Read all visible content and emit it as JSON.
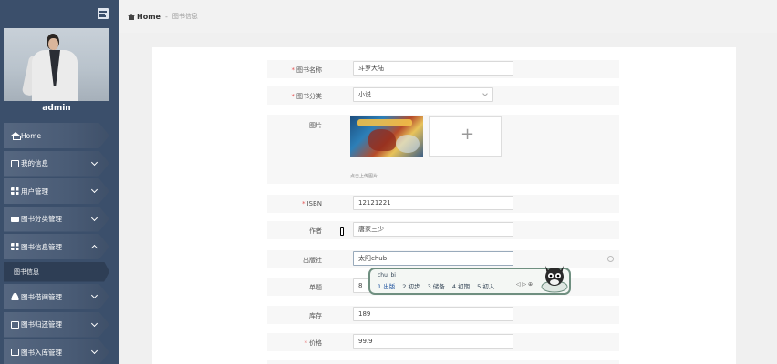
{
  "sidebar": {
    "user_name": "admin",
    "menu": [
      {
        "label": "Home",
        "icon": "home-icon",
        "expandable": false
      },
      {
        "label": "我的信息",
        "icon": "id-card-icon",
        "expandable": true
      },
      {
        "label": "用户管理",
        "icon": "grid-icon",
        "expandable": true
      },
      {
        "label": "图书分类管理",
        "icon": "briefcase-icon",
        "expandable": true
      },
      {
        "label": "图书信息管理",
        "icon": "grid-icon",
        "expandable": true,
        "expanded": true
      }
    ],
    "submenu": [
      {
        "label": "图书信息"
      }
    ],
    "menu_after": [
      {
        "label": "图书借阅管理",
        "icon": "user-icon"
      },
      {
        "label": "图书归还管理",
        "icon": "id-card-icon"
      },
      {
        "label": "图书入库管理",
        "icon": "chart-icon"
      }
    ]
  },
  "breadcrumb": {
    "home": "Home",
    "separator": "-",
    "current": "图书信息"
  },
  "form": {
    "name": {
      "label": "图书名称",
      "value": "斗罗大陆",
      "required": true
    },
    "category": {
      "label": "图书分类",
      "value": "小说",
      "required": true
    },
    "image": {
      "label": "图片",
      "hint": "点击上传图片",
      "add": "+"
    },
    "isbn": {
      "label": "ISBN",
      "value": "12121221",
      "required": true
    },
    "author": {
      "label": "作者",
      "value": "唐家三少"
    },
    "publisher": {
      "label": "出版社",
      "value": "太阳chub|"
    },
    "pages": {
      "label": "单题",
      "value": "8"
    },
    "stock": {
      "label": "库存",
      "value": "189"
    },
    "price": {
      "label": "价格",
      "value": "99.9",
      "required": true
    }
  },
  "ime": {
    "pinyin": "chu' bi",
    "candidates": [
      "1.出版",
      "2.初步",
      "3.储备",
      "4.初期",
      "5.初入"
    ],
    "arrows": "◁ ▷ ⊕"
  },
  "colors": {
    "sidebar": "#3b4f6b",
    "required": "#e55353",
    "ime_border": "#6f8f80"
  }
}
